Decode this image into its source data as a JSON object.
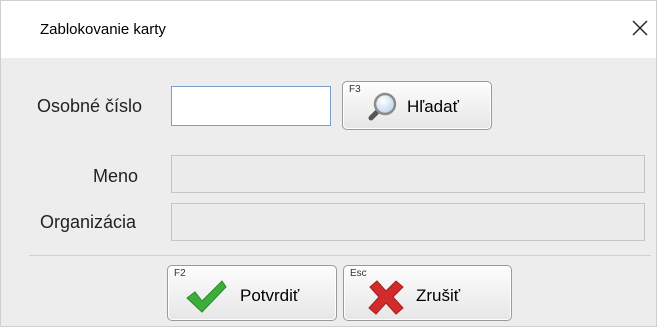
{
  "window": {
    "title": "Zablokovanie karty",
    "close_glyph": "✕"
  },
  "form": {
    "personal_number_label": "Osobné číslo",
    "personal_number_value": "",
    "name_label": "Meno",
    "name_value": "",
    "organization_label": "Organizácia",
    "organization_value": ""
  },
  "buttons": {
    "search": {
      "hotkey": "F3",
      "label": "Hľadať",
      "icon": "magnifier-icon"
    },
    "confirm": {
      "hotkey": "F2",
      "label": "Potvrdiť",
      "icon": "checkmark-icon"
    },
    "cancel": {
      "hotkey": "Esc",
      "label": "Zrušiť",
      "icon": "cross-icon"
    }
  },
  "colors": {
    "confirm_icon": "#3cae3a",
    "cancel_icon": "#d22b2b",
    "focus_border": "#7a9cc9"
  }
}
